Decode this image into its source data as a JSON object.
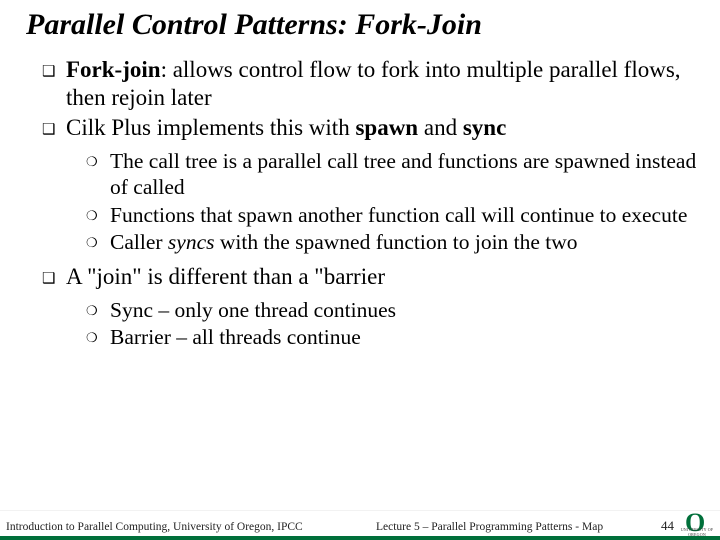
{
  "title": "Parallel Control Patterns: Fork-Join",
  "b1": {
    "term": "Fork-join",
    "rest": ": allows control flow to fork into multiple parallel flows, then rejoin later"
  },
  "b2": {
    "pre": "Cilk Plus implements this with ",
    "k1": "spawn",
    "mid": " and ",
    "k2": "sync"
  },
  "s1": "The call tree is a parallel call tree and functions are spawned instead of called",
  "s2": "Functions that spawn another function call will continue to execute",
  "s3": {
    "pre": "Caller ",
    "em": "syncs",
    "post": " with the spawned function to join the two"
  },
  "b3": "A \"join\" is different than a \"barrier",
  "s4": "Sync – only one thread continues",
  "s5": "Barrier – all threads continue",
  "footer": {
    "left": "Introduction to Parallel Computing, University of Oregon, IPCC",
    "center": "Lecture 5 – Parallel Programming Patterns - Map",
    "page": "44",
    "logo_caption": "UNIVERSITY OF OREGON"
  },
  "glyph": {
    "square": "❑",
    "circle": "❍"
  }
}
